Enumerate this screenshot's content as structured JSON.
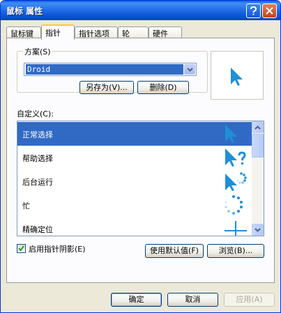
{
  "window": {
    "title": "鼠标 属性",
    "help_icon": "question-mark-icon",
    "close_icon": "close-x-icon"
  },
  "tabs": [
    {
      "label": "鼠标键"
    },
    {
      "label": "指针"
    },
    {
      "label": "指针选项"
    },
    {
      "label": "轮"
    },
    {
      "label": "硬件"
    }
  ],
  "scheme": {
    "legend": "方案(S)",
    "selected_value": "Droid",
    "save_as_label": "另存为(V)...",
    "delete_label": "删除(D)"
  },
  "customize": {
    "label": "自定义(C):",
    "items": [
      {
        "label": "正常选择",
        "icon": "arrow-cursor-icon",
        "selected": true
      },
      {
        "label": "帮助选择",
        "icon": "help-cursor-icon",
        "selected": false
      },
      {
        "label": "后台运行",
        "icon": "working-in-background-cursor-icon",
        "selected": false
      },
      {
        "label": "忙",
        "icon": "busy-cursor-icon",
        "selected": false
      },
      {
        "label": "精确定位",
        "icon": "crosshair-cursor-icon",
        "selected": false
      }
    ]
  },
  "options": {
    "shadow_label": "启用指针阴影(E)",
    "shadow_checked": true,
    "use_default_label": "使用默认值(F)",
    "browse_label": "浏览(B)..."
  },
  "footer": {
    "ok_label": "确定",
    "cancel_label": "取消",
    "apply_label": "应用(A)"
  },
  "colors": {
    "accent": "#316AC5",
    "cursor_blue": "#1E8FD8"
  }
}
